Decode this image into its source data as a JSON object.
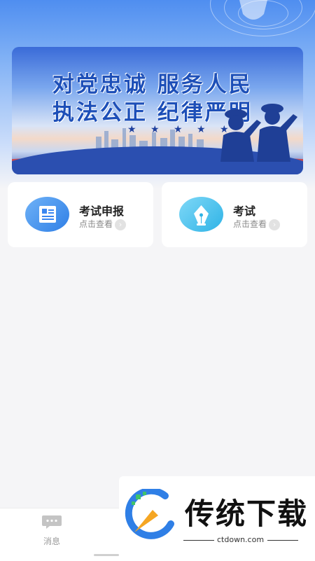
{
  "banner": {
    "line1": "对党忠诚  服务人民",
    "line2": "执法公正  纪律严明",
    "stars": "★ ★ ★ ★ ★"
  },
  "cards": [
    {
      "title": "考试申报",
      "subtitle": "点击查看",
      "icon": "document-icon"
    },
    {
      "title": "考试",
      "subtitle": "点击查看",
      "icon": "pen-nib-icon"
    }
  ],
  "tabbar": {
    "items": [
      {
        "label": "消息",
        "icon": "chat-icon"
      }
    ]
  },
  "watermark": {
    "brand": "传统下载",
    "url": "ctdown.com"
  },
  "colors": {
    "accent": "#3a86f0",
    "banner_text": "#1d4fb8"
  }
}
